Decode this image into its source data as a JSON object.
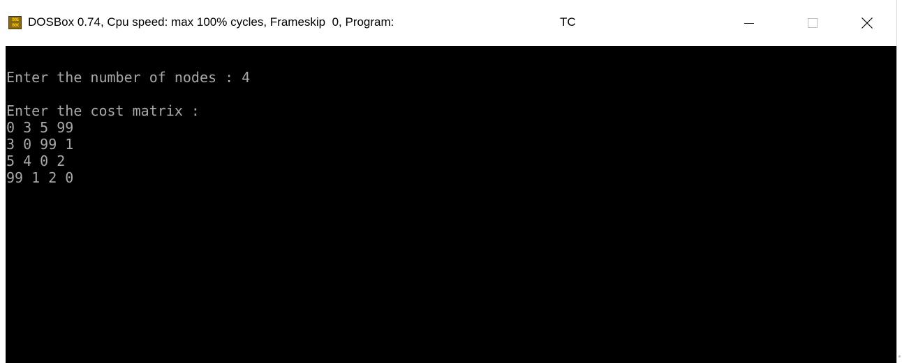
{
  "window": {
    "title": "DOSBox 0.74, Cpu speed: max 100% cycles, Frameskip  0, Program:",
    "program": "TC",
    "icon": {
      "name": "dosbox-icon",
      "text_top": "DOS",
      "text_bottom": "BOX"
    },
    "controls": {
      "minimize": "minimize-icon",
      "maximize": "maximize-icon",
      "close": "close-icon"
    }
  },
  "console": {
    "lines": [
      "Enter the number of nodes : 4",
      "",
      "Enter the cost matrix :",
      "0 3 5 99",
      "3 0 99 1",
      "5 4 0 2",
      "99 1 2 0"
    ]
  },
  "colors": {
    "console_bg": "#000000",
    "console_text": "#a8a8a8",
    "titlebar_bg": "#ffffff",
    "icon_bg": "#8a6a10",
    "icon_text": "#ffd200"
  }
}
